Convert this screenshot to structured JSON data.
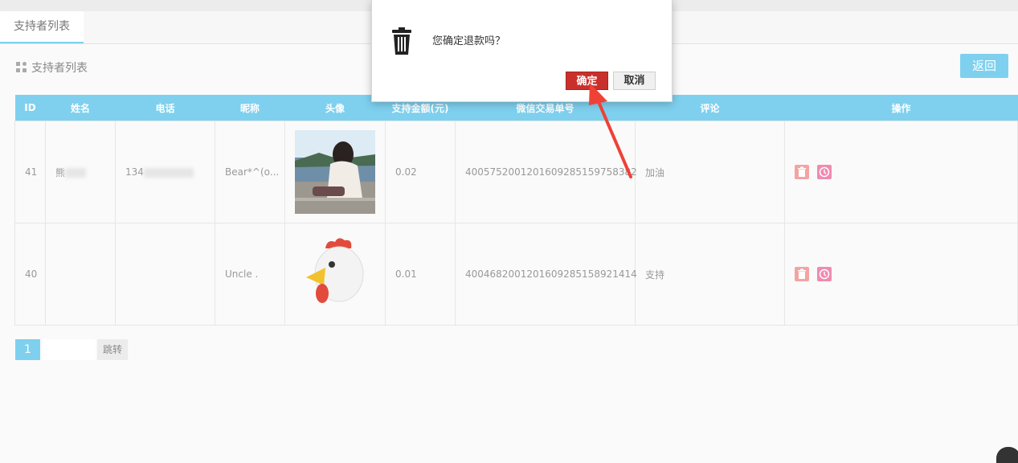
{
  "tabs": [
    {
      "label": "支持者列表"
    }
  ],
  "section": {
    "title": "支持者列表",
    "back_label": "返回"
  },
  "table": {
    "columns": [
      "ID",
      "姓名",
      "电话",
      "昵称",
      "头像",
      "支持金额(元)",
      "微信交易单号",
      "评论",
      "操作"
    ],
    "rows": [
      {
        "id": "41",
        "name": "熊",
        "phone": "134",
        "nickname": "Bear*^(o...",
        "amount": "0.02",
        "trade_no": "4005752001201609285159758382",
        "comment": "加油"
      },
      {
        "id": "40",
        "name": "",
        "phone": "",
        "nickname": "Uncle .",
        "amount": "0.01",
        "trade_no": "4004682001201609285158921414",
        "comment": "支持"
      }
    ]
  },
  "pager": {
    "current": "1",
    "jump_label": "跳转"
  },
  "dialog": {
    "message": "您确定退款吗？",
    "ok_label": "确定",
    "cancel_label": "取消"
  },
  "colors": {
    "accent": "#7ed0ee",
    "danger": "#c9302c",
    "arrow": "#ef4136"
  },
  "icons": {
    "grid": "grid-icon",
    "trash": "trash-icon",
    "refund": "refund-icon"
  }
}
